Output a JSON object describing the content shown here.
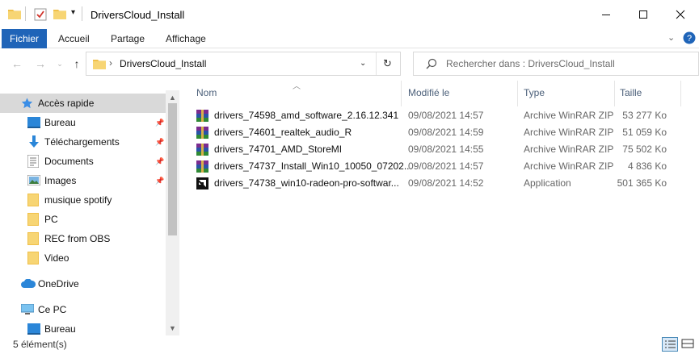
{
  "window": {
    "title": "DriversCloud_Install",
    "controls": {
      "minimize": "—",
      "maximize": "☐",
      "close": "✕"
    }
  },
  "ribbon": {
    "tabs": [
      "Fichier",
      "Accueil",
      "Partage",
      "Affichage"
    ],
    "expand_icon": "chevron-down-icon",
    "help_icon": "help-icon"
  },
  "address": {
    "separator": "›",
    "path": "DriversCloud_Install",
    "search_placeholder": "Rechercher dans : DriversCloud_Install"
  },
  "sidebar": {
    "items": [
      {
        "label": "Accès rapide",
        "icon": "star-icon",
        "pinned": false,
        "selected": true
      },
      {
        "label": "Bureau",
        "icon": "desktop-icon",
        "pinned": true
      },
      {
        "label": "Téléchargements",
        "icon": "download-icon",
        "pinned": true
      },
      {
        "label": "Documents",
        "icon": "documents-icon",
        "pinned": true
      },
      {
        "label": "Images",
        "icon": "pictures-icon",
        "pinned": true
      },
      {
        "label": "musique spotify",
        "icon": "folder-icon",
        "pinned": false
      },
      {
        "label": "PC",
        "icon": "folder-icon",
        "pinned": false
      },
      {
        "label": "REC from OBS",
        "icon": "folder-icon",
        "pinned": false
      },
      {
        "label": "Video",
        "icon": "folder-icon",
        "pinned": false
      },
      {
        "label": "OneDrive",
        "icon": "cloud-icon",
        "pinned": false
      },
      {
        "label": "Ce PC",
        "icon": "computer-icon",
        "pinned": false
      },
      {
        "label": "Bureau",
        "icon": "desktop-icon",
        "pinned": false
      }
    ]
  },
  "columns": {
    "name": "Nom",
    "modified": "Modifié le",
    "type": "Type",
    "size": "Taille"
  },
  "files": [
    {
      "name": "drivers_74598_amd_software_2.16.12.341",
      "modified": "09/08/2021 14:57",
      "type": "Archive WinRAR ZIP",
      "size": "53 277 Ko",
      "icon": "winrar-icon"
    },
    {
      "name": "drivers_74601_realtek_audio_R",
      "modified": "09/08/2021 14:59",
      "type": "Archive WinRAR ZIP",
      "size": "51 059 Ko",
      "icon": "winrar-icon"
    },
    {
      "name": "drivers_74701_AMD_StoreMI",
      "modified": "09/08/2021 14:55",
      "type": "Archive WinRAR ZIP",
      "size": "75 502 Ko",
      "icon": "winrar-icon"
    },
    {
      "name": "drivers_74737_Install_Win10_10050_07202...",
      "modified": "09/08/2021 14:57",
      "type": "Archive WinRAR ZIP",
      "size": "4 836 Ko",
      "icon": "winrar-icon"
    },
    {
      "name": "drivers_74738_win10-radeon-pro-softwar...",
      "modified": "09/08/2021 14:52",
      "type": "Application",
      "size": "501 365 Ko",
      "icon": "amd-app-icon"
    }
  ],
  "status": {
    "count": "5 élément(s)"
  },
  "colors": {
    "accent": "#1f64b8",
    "folder": "#f0c04a",
    "selected": "#d9d9d9"
  }
}
